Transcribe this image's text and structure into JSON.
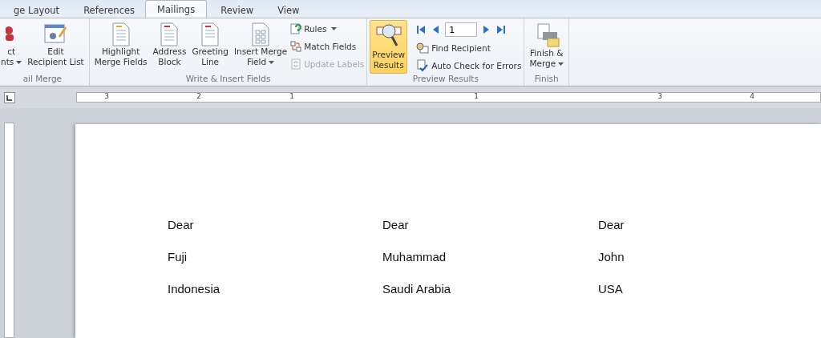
{
  "tabs": [
    {
      "label": "ge Layout",
      "selected": false
    },
    {
      "label": "References",
      "selected": false
    },
    {
      "label": "Mailings",
      "selected": true
    },
    {
      "label": "Review",
      "selected": false
    },
    {
      "label": "View",
      "selected": false
    }
  ],
  "ribbon": {
    "groups": [
      {
        "label": "ail Merge",
        "large_buttons": [
          {
            "lines": [
              "ct",
              "nts"
            ],
            "dropdown": true,
            "selected": false
          },
          {
            "lines": [
              "Edit",
              "Recipient List"
            ],
            "dropdown": false,
            "selected": false
          }
        ]
      },
      {
        "label": "Write & Insert Fields",
        "large_buttons": [
          {
            "lines": [
              "Highlight",
              "Merge Fields"
            ],
            "dropdown": false,
            "selected": false
          },
          {
            "lines": [
              "Address",
              "Block"
            ],
            "dropdown": false,
            "selected": false
          },
          {
            "lines": [
              "Greeting",
              "Line"
            ],
            "dropdown": false,
            "selected": false
          },
          {
            "lines": [
              "Insert Merge",
              "Field"
            ],
            "dropdown": true,
            "selected": false
          }
        ],
        "small_buttons": [
          {
            "label": "Rules",
            "dropdown": true,
            "disabled": false
          },
          {
            "label": "Match Fields",
            "dropdown": false,
            "disabled": false
          },
          {
            "label": "Update Labels",
            "dropdown": false,
            "disabled": true
          }
        ]
      },
      {
        "label": "Preview Results",
        "large_buttons": [
          {
            "lines": [
              "Preview",
              "Results"
            ],
            "dropdown": false,
            "selected": true
          }
        ],
        "record": {
          "value": "1"
        },
        "small_buttons": [
          {
            "label": "Find Recipient",
            "dropdown": false,
            "disabled": false
          },
          {
            "label": "Auto Check for Errors",
            "dropdown": false,
            "disabled": false
          }
        ]
      },
      {
        "label": "Finish",
        "large_buttons": [
          {
            "lines": [
              "Finish &",
              "Merge"
            ],
            "dropdown": true,
            "selected": false
          }
        ]
      }
    ]
  },
  "ruler": {
    "numbers": [
      "3",
      "2",
      "1",
      "1",
      "3",
      "4"
    ]
  },
  "document": {
    "records": [
      {
        "lines": [
          "Dear",
          "Fuji",
          "Indonesia"
        ]
      },
      {
        "lines": [
          "Dear",
          "Muhammad",
          "Saudi Arabia"
        ]
      },
      {
        "lines": [
          "Dear",
          "John",
          "USA"
        ]
      }
    ]
  }
}
